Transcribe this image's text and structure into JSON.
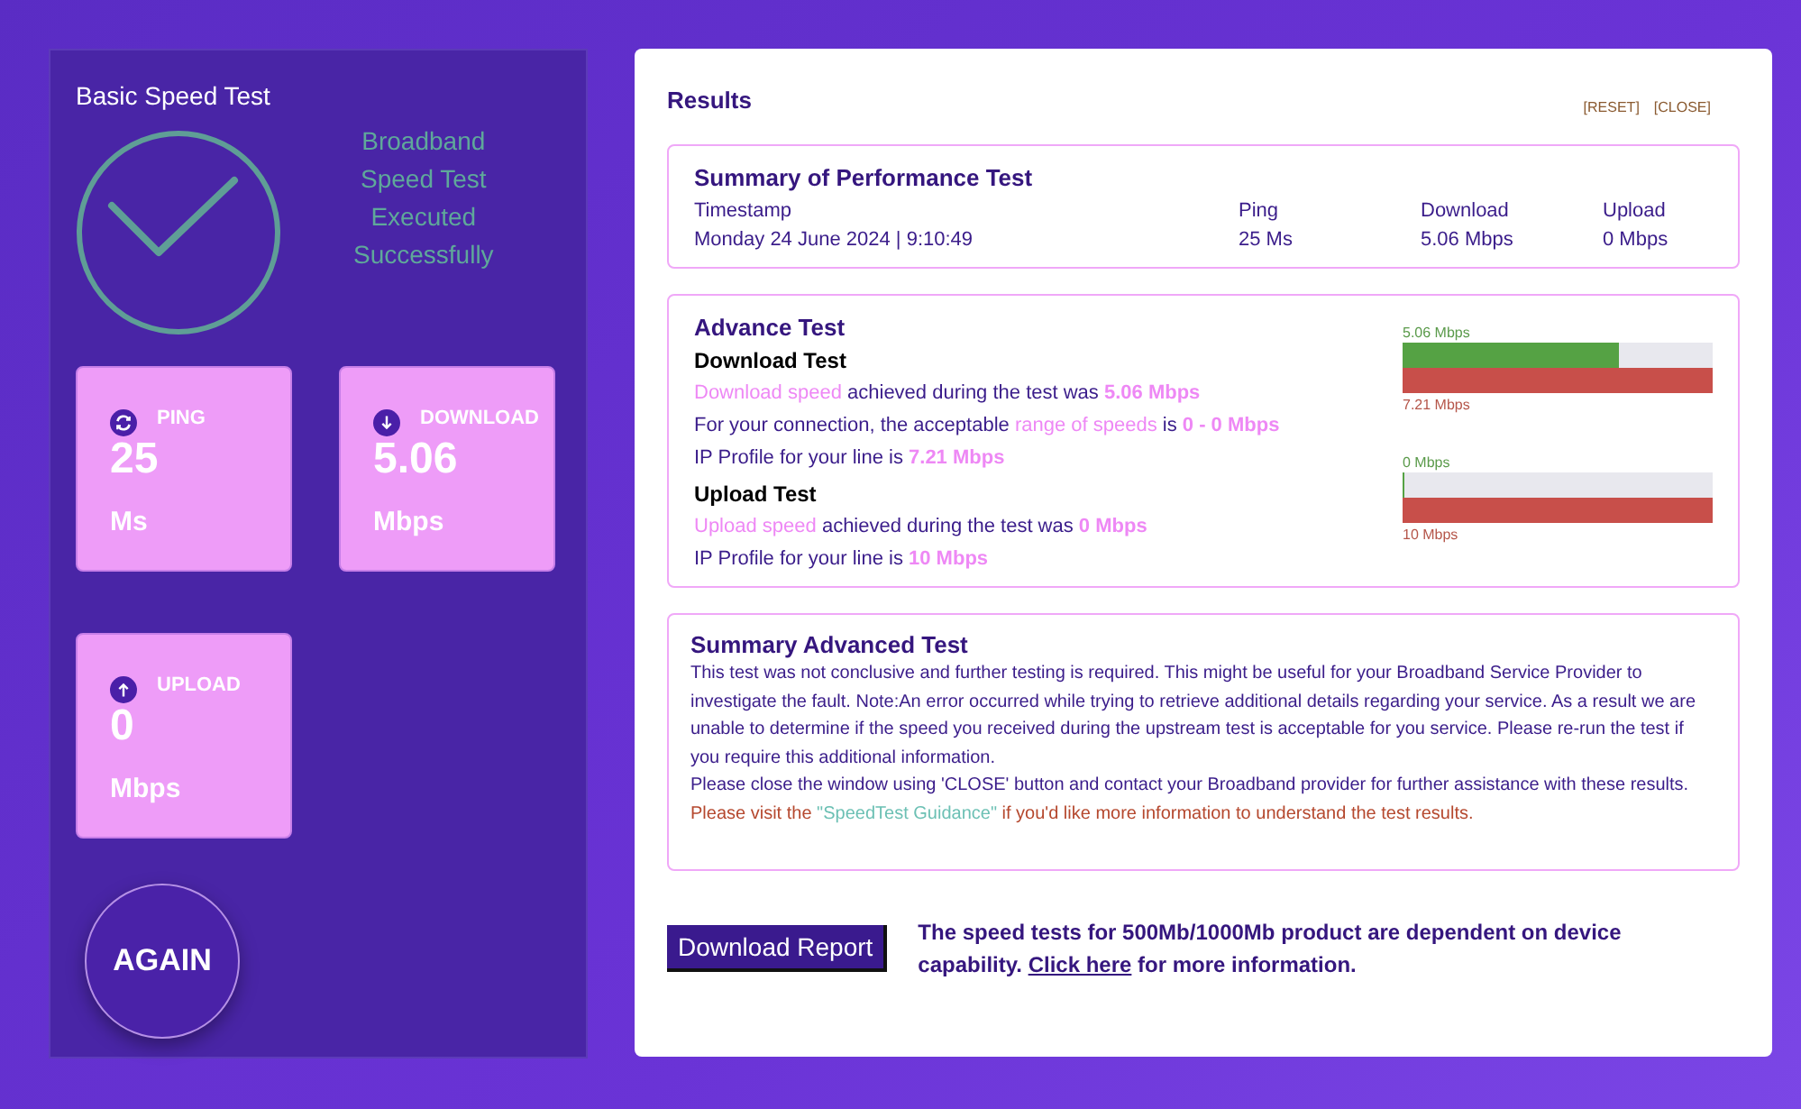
{
  "basic": {
    "title": "Basic Speed Test",
    "status_lines": [
      "Broadband",
      "Speed Test",
      "Executed",
      "Successfully"
    ],
    "tiles": [
      {
        "kind": "ping",
        "label": "PING",
        "value": "25",
        "unit": "Ms"
      },
      {
        "kind": "download",
        "label": "DOWNLOAD",
        "value": "5.06",
        "unit": "Mbps"
      },
      {
        "kind": "upload",
        "label": "UPLOAD",
        "value": "0",
        "unit": "Mbps"
      }
    ],
    "again_button": "AGAIN"
  },
  "results": {
    "title": "Results",
    "actions": [
      "[RESET]",
      "[CLOSE]"
    ],
    "summary": {
      "title": "Summary of Performance Test",
      "columns": [
        {
          "heading": "Timestamp",
          "value": "Monday 24 June 2024 | 9:10:49"
        },
        {
          "heading": "Ping",
          "value": "25 Ms"
        },
        {
          "heading": "Download",
          "value": "5.06 Mbps"
        },
        {
          "heading": "Upload",
          "value": "0 Mbps"
        }
      ]
    },
    "advance": {
      "title": "Advance Test",
      "sections": [
        {
          "title": "Download Test",
          "lines": [
            [
              {
                "text": "Download speed",
                "highlight": true
              },
              {
                "text": " achieved during the test was ",
                "highlight": false
              },
              {
                "text": "5.06 Mbps",
                "highlight": true,
                "bold": true
              }
            ],
            [
              {
                "text": "For your connection, the acceptable ",
                "highlight": false
              },
              {
                "text": "range of speeds",
                "highlight": true
              },
              {
                "text": " is ",
                "highlight": false
              },
              {
                "text": "0 - 0 Mbps",
                "highlight": true,
                "bold": true
              }
            ],
            [
              {
                "text": "IP Profile for your line is ",
                "highlight": false
              },
              {
                "text": "7.21 Mbps",
                "highlight": true,
                "bold": true
              }
            ]
          ],
          "meter": {
            "speed_label": "5.06 Mbps",
            "level": 0.7,
            "profile_label": "7.21 Mbps"
          }
        },
        {
          "title": "Upload Test",
          "lines": [
            [
              {
                "text": "Upload speed",
                "highlight": true
              },
              {
                "text": " achieved during the test was ",
                "highlight": false
              },
              {
                "text": "0 Mbps",
                "highlight": true,
                "bold": true
              }
            ],
            [
              {
                "text": "IP Profile for your line is ",
                "highlight": false
              },
              {
                "text": "10 Mbps",
                "highlight": true,
                "bold": true
              }
            ]
          ],
          "meter": {
            "speed_label": "0 Mbps",
            "level": 0,
            "profile_label": "10 Mbps"
          }
        }
      ]
    },
    "summary_advanced": {
      "title": "Summary Advanced Test",
      "paragraph": "This test was not conclusive and further testing is required. This might be useful for your Broadband Service Provider to investigate the fault. Note:An error occurred while trying to retrieve additional details regarding your service. As a result we are unable to determine if the speed you received during the upstream test is acceptable for you service. Please re-run the test if you require this additional information.",
      "close_note": "Please close the window using 'CLOSE' button and contact your Broadband provider for further assistance with these results.",
      "guidance": {
        "before": "Please visit the ",
        "link": "\"SpeedTest Guidance\"",
        "after": " if you'd like more information to understand the test results."
      }
    },
    "download_report_button": "Download Report",
    "note": {
      "before": "The speed tests for 500Mb/1000Mb product are dependent on device capability. ",
      "link": "Click here",
      "after": " for more information."
    }
  }
}
